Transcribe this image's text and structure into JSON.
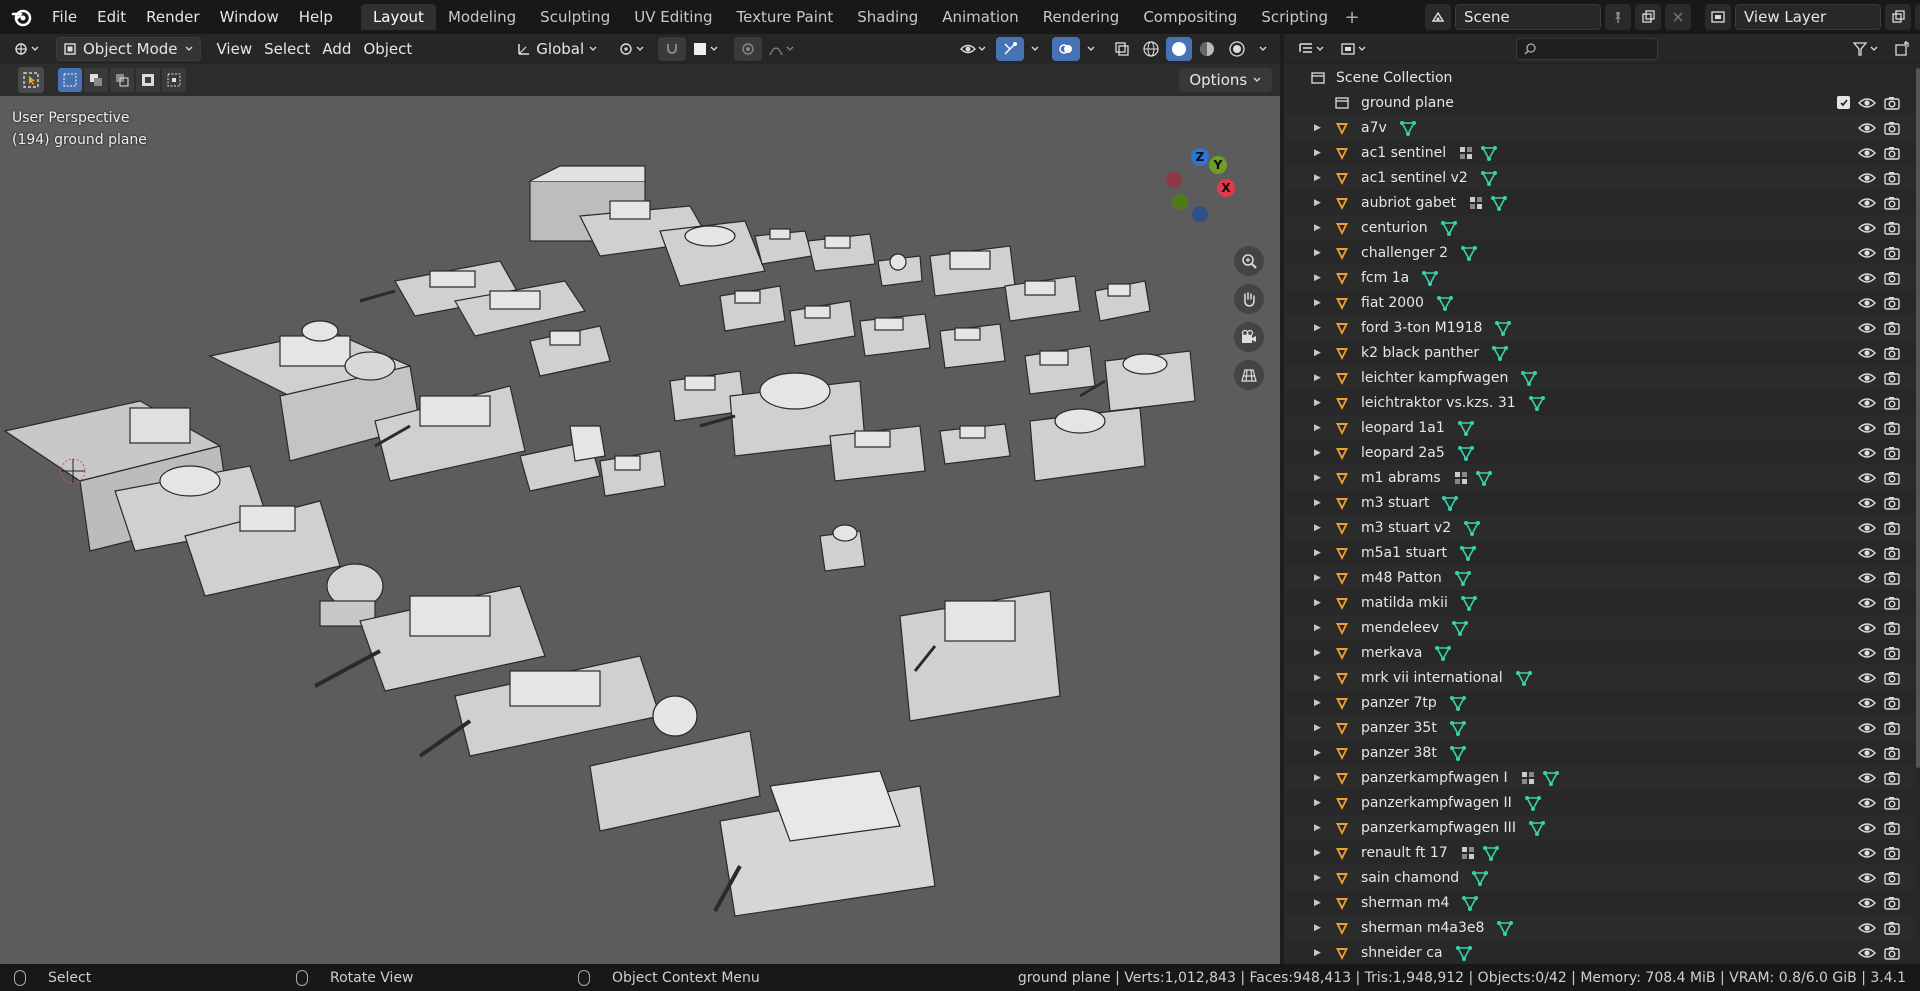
{
  "topbar": {
    "menus": [
      "File",
      "Edit",
      "Render",
      "Window",
      "Help"
    ],
    "workspaces": [
      "Layout",
      "Modeling",
      "Sculpting",
      "UV Editing",
      "Texture Paint",
      "Shading",
      "Animation",
      "Rendering",
      "Compositing",
      "Scripting"
    ],
    "active_workspace": "Layout",
    "add_tab": "+",
    "scene_name": "Scene",
    "view_layer_name": "View Layer"
  },
  "viewport": {
    "mode": "Object Mode",
    "menus": [
      "View",
      "Select",
      "Add",
      "Object"
    ],
    "transform_orientation": "Global",
    "options_label": "Options",
    "perspective_label": "User Perspective",
    "active_object_label": "(194) ground plane",
    "gizmo_axes": {
      "z": "Z",
      "y": "Y",
      "x": "X"
    },
    "colors": {
      "background": "#5c5c5c",
      "x_axis": "#e2384c",
      "y_axis": "#6f9c26",
      "z_axis": "#2d74d4",
      "accent": "#4772b3"
    }
  },
  "outliner": {
    "root": "Scene Collection",
    "items": [
      {
        "name": "ground plane",
        "type": "collection",
        "extra": []
      },
      {
        "name": "a7v",
        "type": "object",
        "extra": [
          "mesh"
        ]
      },
      {
        "name": "ac1 sentinel",
        "type": "object",
        "extra": [
          "modifier",
          "mesh"
        ]
      },
      {
        "name": "ac1 sentinel v2",
        "type": "object",
        "extra": [
          "mesh"
        ]
      },
      {
        "name": "aubriot gabet",
        "type": "object",
        "extra": [
          "modifier",
          "mesh"
        ]
      },
      {
        "name": "centurion",
        "type": "object",
        "extra": [
          "mesh"
        ]
      },
      {
        "name": "challenger 2",
        "type": "object",
        "extra": [
          "mesh"
        ]
      },
      {
        "name": "fcm 1a",
        "type": "object",
        "extra": [
          "mesh"
        ]
      },
      {
        "name": "fiat 2000",
        "type": "object",
        "extra": [
          "mesh"
        ]
      },
      {
        "name": "ford 3-ton M1918",
        "type": "object",
        "extra": [
          "mesh"
        ]
      },
      {
        "name": "k2 black panther",
        "type": "object",
        "extra": [
          "mesh"
        ]
      },
      {
        "name": "leichter kampfwagen",
        "type": "object",
        "extra": [
          "mesh"
        ]
      },
      {
        "name": "leichtraktor vs.kzs. 31",
        "type": "object",
        "extra": [
          "mesh"
        ]
      },
      {
        "name": "leopard 1a1",
        "type": "object",
        "extra": [
          "mesh"
        ]
      },
      {
        "name": "leopard 2a5",
        "type": "object",
        "extra": [
          "mesh"
        ]
      },
      {
        "name": "m1 abrams",
        "type": "object",
        "extra": [
          "modifier",
          "mesh"
        ]
      },
      {
        "name": "m3 stuart",
        "type": "object",
        "extra": [
          "mesh"
        ]
      },
      {
        "name": "m3 stuart v2",
        "type": "object",
        "extra": [
          "mesh"
        ]
      },
      {
        "name": "m5a1 stuart",
        "type": "object",
        "extra": [
          "mesh"
        ]
      },
      {
        "name": "m48 Patton",
        "type": "object",
        "extra": [
          "mesh"
        ]
      },
      {
        "name": "matilda mkii",
        "type": "object",
        "extra": [
          "mesh"
        ]
      },
      {
        "name": "mendeleev",
        "type": "object",
        "extra": [
          "mesh"
        ]
      },
      {
        "name": "merkava",
        "type": "object",
        "extra": [
          "mesh"
        ]
      },
      {
        "name": "mrk vii international",
        "type": "object",
        "extra": [
          "mesh"
        ]
      },
      {
        "name": "panzer 7tp",
        "type": "object",
        "extra": [
          "mesh"
        ]
      },
      {
        "name": "panzer 35t",
        "type": "object",
        "extra": [
          "mesh"
        ]
      },
      {
        "name": "panzer 38t",
        "type": "object",
        "extra": [
          "mesh"
        ]
      },
      {
        "name": "panzerkampfwagen I",
        "type": "object",
        "extra": [
          "modifier",
          "mesh"
        ]
      },
      {
        "name": "panzerkampfwagen II",
        "type": "object",
        "extra": [
          "mesh"
        ]
      },
      {
        "name": "panzerkampfwagen III",
        "type": "object",
        "extra": [
          "mesh"
        ]
      },
      {
        "name": "renault ft 17",
        "type": "object",
        "extra": [
          "modifier",
          "mesh"
        ]
      },
      {
        "name": "sain chamond",
        "type": "object",
        "extra": [
          "mesh"
        ]
      },
      {
        "name": "sherman m4",
        "type": "object",
        "extra": [
          "mesh"
        ]
      },
      {
        "name": "sherman m4a3e8",
        "type": "object",
        "extra": [
          "mesh"
        ]
      },
      {
        "name": "shneider ca",
        "type": "object",
        "extra": [
          "mesh"
        ]
      }
    ]
  },
  "statusbar": {
    "left_action": "Select",
    "middle_action": "Rotate View",
    "right_action": "Object Context Menu",
    "stats": "ground plane | Verts:1,012,843 | Faces:948,413 | Tris:1,948,912 | Objects:0/42 | Memory: 708.4 MiB | VRAM: 0.8/6.0 GiB | 3.4.1"
  }
}
